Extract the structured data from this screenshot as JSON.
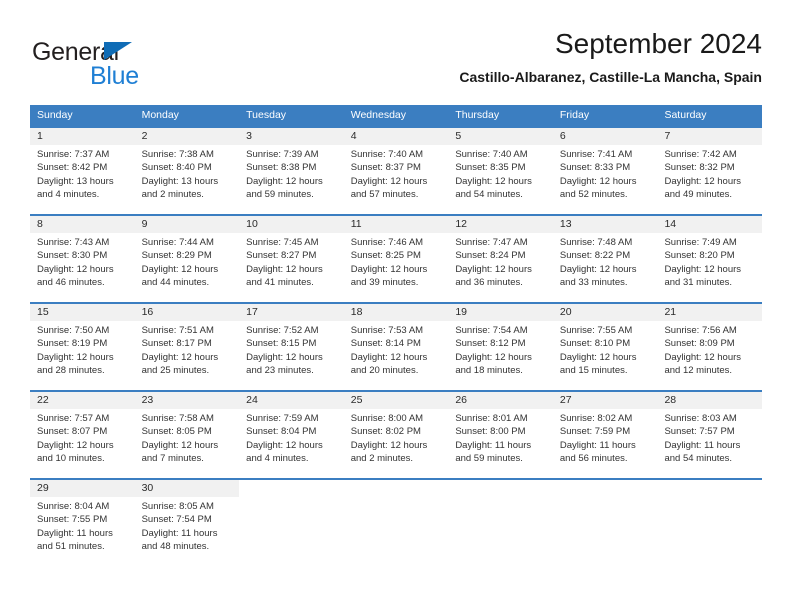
{
  "brand": {
    "name_part1": "General",
    "name_part2": "Blue",
    "triangle_icon": "triangle-icon",
    "color_dark": "#231f20",
    "color_blue": "#1f7fd4"
  },
  "header": {
    "title": "September 2024",
    "subtitle": "Castillo-Albaranez, Castille-La Mancha, Spain"
  },
  "theme": {
    "header_bg": "#3b7ec1",
    "daynum_bg": "#f1f1f1",
    "text": "#333333"
  },
  "weekdays": [
    "Sunday",
    "Monday",
    "Tuesday",
    "Wednesday",
    "Thursday",
    "Friday",
    "Saturday"
  ],
  "weeks": [
    [
      {
        "day": "1",
        "sunrise": "Sunrise: 7:37 AM",
        "sunset": "Sunset: 8:42 PM",
        "daylight_line1": "Daylight: 13 hours",
        "daylight_line2": "and 4 minutes."
      },
      {
        "day": "2",
        "sunrise": "Sunrise: 7:38 AM",
        "sunset": "Sunset: 8:40 PM",
        "daylight_line1": "Daylight: 13 hours",
        "daylight_line2": "and 2 minutes."
      },
      {
        "day": "3",
        "sunrise": "Sunrise: 7:39 AM",
        "sunset": "Sunset: 8:38 PM",
        "daylight_line1": "Daylight: 12 hours",
        "daylight_line2": "and 59 minutes."
      },
      {
        "day": "4",
        "sunrise": "Sunrise: 7:40 AM",
        "sunset": "Sunset: 8:37 PM",
        "daylight_line1": "Daylight: 12 hours",
        "daylight_line2": "and 57 minutes."
      },
      {
        "day": "5",
        "sunrise": "Sunrise: 7:40 AM",
        "sunset": "Sunset: 8:35 PM",
        "daylight_line1": "Daylight: 12 hours",
        "daylight_line2": "and 54 minutes."
      },
      {
        "day": "6",
        "sunrise": "Sunrise: 7:41 AM",
        "sunset": "Sunset: 8:33 PM",
        "daylight_line1": "Daylight: 12 hours",
        "daylight_line2": "and 52 minutes."
      },
      {
        "day": "7",
        "sunrise": "Sunrise: 7:42 AM",
        "sunset": "Sunset: 8:32 PM",
        "daylight_line1": "Daylight: 12 hours",
        "daylight_line2": "and 49 minutes."
      }
    ],
    [
      {
        "day": "8",
        "sunrise": "Sunrise: 7:43 AM",
        "sunset": "Sunset: 8:30 PM",
        "daylight_line1": "Daylight: 12 hours",
        "daylight_line2": "and 46 minutes."
      },
      {
        "day": "9",
        "sunrise": "Sunrise: 7:44 AM",
        "sunset": "Sunset: 8:29 PM",
        "daylight_line1": "Daylight: 12 hours",
        "daylight_line2": "and 44 minutes."
      },
      {
        "day": "10",
        "sunrise": "Sunrise: 7:45 AM",
        "sunset": "Sunset: 8:27 PM",
        "daylight_line1": "Daylight: 12 hours",
        "daylight_line2": "and 41 minutes."
      },
      {
        "day": "11",
        "sunrise": "Sunrise: 7:46 AM",
        "sunset": "Sunset: 8:25 PM",
        "daylight_line1": "Daylight: 12 hours",
        "daylight_line2": "and 39 minutes."
      },
      {
        "day": "12",
        "sunrise": "Sunrise: 7:47 AM",
        "sunset": "Sunset: 8:24 PM",
        "daylight_line1": "Daylight: 12 hours",
        "daylight_line2": "and 36 minutes."
      },
      {
        "day": "13",
        "sunrise": "Sunrise: 7:48 AM",
        "sunset": "Sunset: 8:22 PM",
        "daylight_line1": "Daylight: 12 hours",
        "daylight_line2": "and 33 minutes."
      },
      {
        "day": "14",
        "sunrise": "Sunrise: 7:49 AM",
        "sunset": "Sunset: 8:20 PM",
        "daylight_line1": "Daylight: 12 hours",
        "daylight_line2": "and 31 minutes."
      }
    ],
    [
      {
        "day": "15",
        "sunrise": "Sunrise: 7:50 AM",
        "sunset": "Sunset: 8:19 PM",
        "daylight_line1": "Daylight: 12 hours",
        "daylight_line2": "and 28 minutes."
      },
      {
        "day": "16",
        "sunrise": "Sunrise: 7:51 AM",
        "sunset": "Sunset: 8:17 PM",
        "daylight_line1": "Daylight: 12 hours",
        "daylight_line2": "and 25 minutes."
      },
      {
        "day": "17",
        "sunrise": "Sunrise: 7:52 AM",
        "sunset": "Sunset: 8:15 PM",
        "daylight_line1": "Daylight: 12 hours",
        "daylight_line2": "and 23 minutes."
      },
      {
        "day": "18",
        "sunrise": "Sunrise: 7:53 AM",
        "sunset": "Sunset: 8:14 PM",
        "daylight_line1": "Daylight: 12 hours",
        "daylight_line2": "and 20 minutes."
      },
      {
        "day": "19",
        "sunrise": "Sunrise: 7:54 AM",
        "sunset": "Sunset: 8:12 PM",
        "daylight_line1": "Daylight: 12 hours",
        "daylight_line2": "and 18 minutes."
      },
      {
        "day": "20",
        "sunrise": "Sunrise: 7:55 AM",
        "sunset": "Sunset: 8:10 PM",
        "daylight_line1": "Daylight: 12 hours",
        "daylight_line2": "and 15 minutes."
      },
      {
        "day": "21",
        "sunrise": "Sunrise: 7:56 AM",
        "sunset": "Sunset: 8:09 PM",
        "daylight_line1": "Daylight: 12 hours",
        "daylight_line2": "and 12 minutes."
      }
    ],
    [
      {
        "day": "22",
        "sunrise": "Sunrise: 7:57 AM",
        "sunset": "Sunset: 8:07 PM",
        "daylight_line1": "Daylight: 12 hours",
        "daylight_line2": "and 10 minutes."
      },
      {
        "day": "23",
        "sunrise": "Sunrise: 7:58 AM",
        "sunset": "Sunset: 8:05 PM",
        "daylight_line1": "Daylight: 12 hours",
        "daylight_line2": "and 7 minutes."
      },
      {
        "day": "24",
        "sunrise": "Sunrise: 7:59 AM",
        "sunset": "Sunset: 8:04 PM",
        "daylight_line1": "Daylight: 12 hours",
        "daylight_line2": "and 4 minutes."
      },
      {
        "day": "25",
        "sunrise": "Sunrise: 8:00 AM",
        "sunset": "Sunset: 8:02 PM",
        "daylight_line1": "Daylight: 12 hours",
        "daylight_line2": "and 2 minutes."
      },
      {
        "day": "26",
        "sunrise": "Sunrise: 8:01 AM",
        "sunset": "Sunset: 8:00 PM",
        "daylight_line1": "Daylight: 11 hours",
        "daylight_line2": "and 59 minutes."
      },
      {
        "day": "27",
        "sunrise": "Sunrise: 8:02 AM",
        "sunset": "Sunset: 7:59 PM",
        "daylight_line1": "Daylight: 11 hours",
        "daylight_line2": "and 56 minutes."
      },
      {
        "day": "28",
        "sunrise": "Sunrise: 8:03 AM",
        "sunset": "Sunset: 7:57 PM",
        "daylight_line1": "Daylight: 11 hours",
        "daylight_line2": "and 54 minutes."
      }
    ],
    [
      {
        "day": "29",
        "sunrise": "Sunrise: 8:04 AM",
        "sunset": "Sunset: 7:55 PM",
        "daylight_line1": "Daylight: 11 hours",
        "daylight_line2": "and 51 minutes."
      },
      {
        "day": "30",
        "sunrise": "Sunrise: 8:05 AM",
        "sunset": "Sunset: 7:54 PM",
        "daylight_line1": "Daylight: 11 hours",
        "daylight_line2": "and 48 minutes."
      },
      {
        "day": "",
        "sunrise": "",
        "sunset": "",
        "daylight_line1": "",
        "daylight_line2": ""
      },
      {
        "day": "",
        "sunrise": "",
        "sunset": "",
        "daylight_line1": "",
        "daylight_line2": ""
      },
      {
        "day": "",
        "sunrise": "",
        "sunset": "",
        "daylight_line1": "",
        "daylight_line2": ""
      },
      {
        "day": "",
        "sunrise": "",
        "sunset": "",
        "daylight_line1": "",
        "daylight_line2": ""
      },
      {
        "day": "",
        "sunrise": "",
        "sunset": "",
        "daylight_line1": "",
        "daylight_line2": ""
      }
    ]
  ]
}
